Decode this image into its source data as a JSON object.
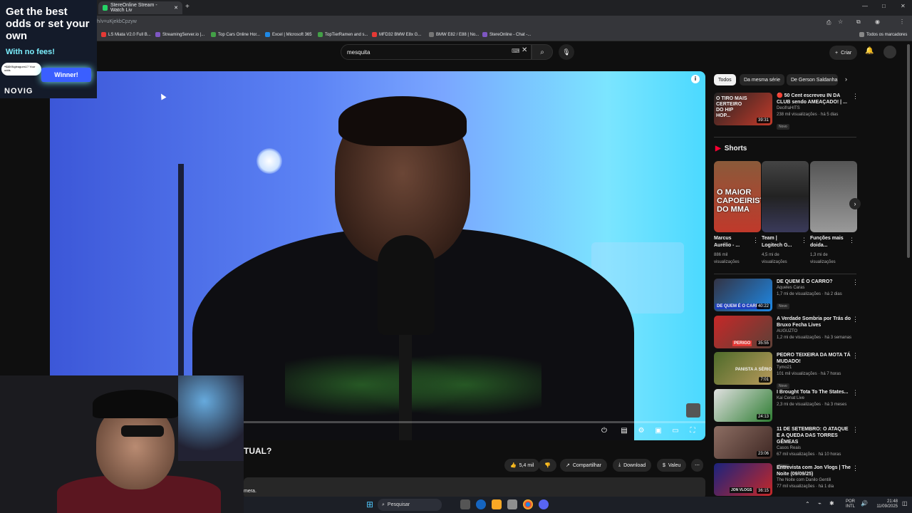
{
  "browser": {
    "tab_title": "StereOnline Stream - Watch Liv",
    "new_tab": "+",
    "url": "h/v=uKjekbCpzyw",
    "bookmarks": [
      "LS Miata V2.0 Full B...",
      "StreamingServer.io |...",
      "Top Cars Online Hor...",
      "Excel | Microsoft 365",
      "TopTierRamen and s...",
      "MFD32 BMW E8x G...",
      "BMW E82 / E88 | No...",
      "StereOnline - Chat -..."
    ],
    "all_bookmarks": "Todos os marcadores",
    "window_controls": [
      "—",
      "□",
      "✕"
    ]
  },
  "masthead": {
    "search_value": "mesquita",
    "create_label": "Criar",
    "bell_icon": "bell-icon",
    "mic_icon": "mic-icon"
  },
  "ad": {
    "headline": "Get the best odds or set your own",
    "subline": "With no fees!",
    "winner": "Winner!",
    "logo": "NOVIG",
    "user_badge": "+110",
    "user_name": "Bigleagues17",
    "user_sub": "Your odds"
  },
  "video": {
    "title_fragment": "TUAL?",
    "desc_fragment": "mera.",
    "controls": [
      "toggle-autoplay",
      "subtitles",
      "settings",
      "miniplayer",
      "theater",
      "fullscreen"
    ]
  },
  "actions": {
    "likes": "5,4 mil",
    "share": "Compartilhar",
    "download": "Download",
    "thanks": "Valeu",
    "more": "⋯"
  },
  "chips": [
    "Todos",
    "Da mesma série",
    "De Gerson Saldanha"
  ],
  "recommendations_top": {
    "title": "🔴 50 Cent escreveu IN DA CLUB sendo AMEAÇADO! | ...",
    "channel": "DecifraHITS",
    "meta": "238 mil visualizações · há 5 dias",
    "badge": "Novo",
    "duration": "39:31",
    "thumb_text": "O TIRO MAIS CERTEIRO DO HIP HOP..."
  },
  "shorts": {
    "title": "Shorts",
    "items": [
      {
        "title": "Marcus Aurélio - ...",
        "views": "886 mil visualizações",
        "thumb_text": "O MAIOR CAPOEIRISTA DO MMA"
      },
      {
        "title": "Team | Logitech G...",
        "views": "4,5 mi de visualizações",
        "thumb_text": ""
      },
      {
        "title": "Funções mais doida...",
        "views": "1,3 mi de visualizações",
        "thumb_text": ""
      }
    ]
  },
  "recommendations": [
    {
      "title": "DE QUEM É O CARRO?",
      "channel": "Aqueles Caras",
      "meta": "1,7 mi de visualizações · há 2 dias",
      "badge": "Novo",
      "duration": "40:22",
      "thumb_text": "DE QUEM É O CARRO"
    },
    {
      "title": "A Verdade Sombria por Trás do Bruxo Fecha Lives",
      "channel": "AUGUZTO",
      "meta": "1,2 mi de visualizações · há 3 semanas",
      "badge": "",
      "duration": "35:55",
      "thumb_text": "PERIGO"
    },
    {
      "title": "PEDRO TEIXEIRA DA MOTA TÁ MUDADO!",
      "channel": "Tymo21",
      "meta": "101 mil visualizações · há 7 horas",
      "badge": "Novo",
      "duration": "7:01",
      "thumb_text": "PANISTA A SÉRIO"
    },
    {
      "title": "I Brought Tota To The States...",
      "channel": "Kai Cenat Live",
      "meta": "2,3 mi de visualizações · há 3 meses",
      "badge": "",
      "duration": "24:13",
      "thumb_text": ""
    },
    {
      "title": "11 DE SETEMBRO: O ATAQUE E A QUEDA DAS TORRES GÊMEAS",
      "channel": "Casos Reais",
      "meta": "67 mil visualizações · há 10 horas",
      "badge": "Novo",
      "duration": "23:06",
      "thumb_text": ""
    },
    {
      "title": "Entrevista com Jon Vlogs | The Noite (09/09/25)",
      "channel": "The Noite com Danilo Gentili",
      "meta": "77 mil visualizações · há 1 dia",
      "badge": "",
      "duration": "36:15",
      "thumb_text": "JON VLOGS"
    }
  ],
  "taskbar": {
    "search": "Pesquisar",
    "lang": "POR",
    "lang2": "INTL",
    "time": "21:48",
    "date": "11/09/2025"
  },
  "colors": {
    "bg": "#0f0f0f",
    "accent_red": "#ff0033",
    "ad_cyan": "#7cf0ff"
  }
}
